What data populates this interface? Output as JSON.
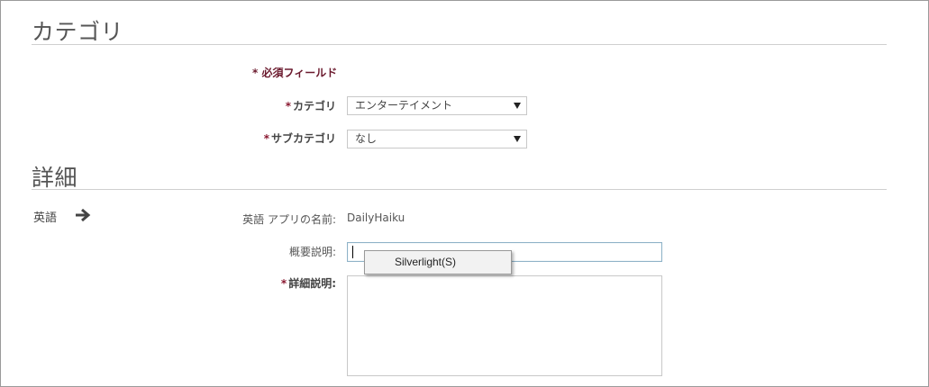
{
  "sections": {
    "category_title": "カテゴリ",
    "details_title": "詳細"
  },
  "required_note": "* 必須フィールド",
  "category_field": {
    "star": "*",
    "label": "カテゴリ",
    "value": "エンターテイメント"
  },
  "subcategory_field": {
    "star": "*",
    "label": "サブカテゴリ",
    "value": "なし"
  },
  "language": {
    "label": "英語",
    "icon": "arrow-right-icon"
  },
  "app_name_field": {
    "label": "英語 アプリの名前:",
    "value": "DailyHaiku"
  },
  "summary_field": {
    "label": "概要説明:",
    "value": ""
  },
  "description_field": {
    "star": "*",
    "label": "詳細説明:",
    "value": ""
  },
  "context_menu": {
    "items": [
      "Silverlight(S)"
    ]
  },
  "colors": {
    "required": "#6b1a2e",
    "input_focus_border": "#8fb3c8",
    "rule": "#cfcfcf"
  }
}
